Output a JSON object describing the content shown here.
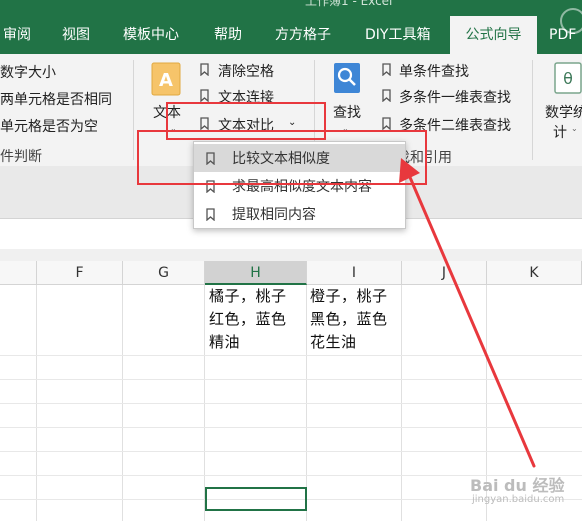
{
  "window": {
    "title": "工作簿1 - Excel"
  },
  "tabs": [
    {
      "label": "审阅"
    },
    {
      "label": "视图"
    },
    {
      "label": "模板中心"
    },
    {
      "label": "帮助"
    },
    {
      "label": "方方格子"
    },
    {
      "label": "DIY工具箱"
    },
    {
      "label": "公式向导",
      "active": true
    },
    {
      "label": "PDF"
    }
  ],
  "ribbon": {
    "left_items": [
      "数字大小",
      "两单元格是否相同",
      "单元格是否为空",
      "件判断"
    ],
    "text_group": {
      "big_label": "文本",
      "items": [
        "清除空格",
        "文本连接",
        "文本对比"
      ]
    },
    "lookup_group": {
      "big_label": "查找",
      "items": [
        "单条件查找",
        "多条件一维表查找",
        "多条件二维表查找"
      ],
      "group_label": "找和引用"
    },
    "math_group": {
      "big_label_line1": "数学统",
      "big_label_line2": "计"
    }
  },
  "dropdown": {
    "items": [
      "比较文本相似度",
      "求最高相似度文本内容",
      "提取相同内容"
    ],
    "highlighted_index": 0
  },
  "sheet": {
    "columns": [
      "F",
      "G",
      "H",
      "I",
      "J",
      "K"
    ],
    "selected_column": "H",
    "cells": {
      "H": [
        "橘子，桃子",
        "红色，蓝色",
        "精油"
      ],
      "I": [
        "橙子，桃子",
        "黑色，蓝色",
        "花生油"
      ]
    }
  },
  "watermark": {
    "brand": "Bai du 经验",
    "url": "jingyan.baidu.com"
  },
  "colors": {
    "accent": "#217346",
    "annotation": "#e8383d"
  }
}
